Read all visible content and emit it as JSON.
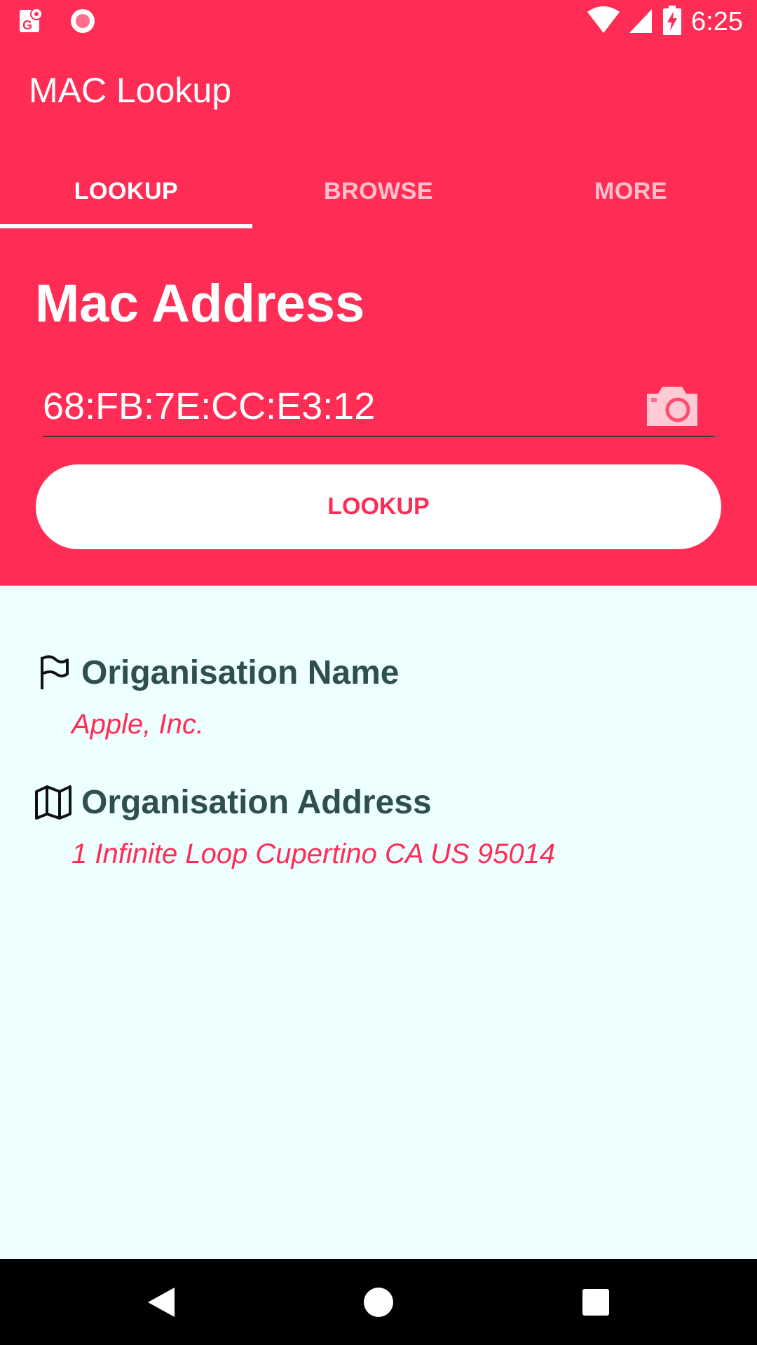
{
  "status_bar": {
    "time": "6:25",
    "icons": [
      "gallery-map-icon",
      "record-icon",
      "wifi-icon",
      "signal-icon",
      "battery-charging-icon"
    ]
  },
  "app_bar": {
    "title": "MAC Lookup"
  },
  "tabs": [
    {
      "label": "LOOKUP",
      "selected": true
    },
    {
      "label": "BROWSE",
      "selected": false
    },
    {
      "label": "MORE",
      "selected": false
    }
  ],
  "form": {
    "heading": "Mac Address",
    "mac_value": "68:FB:7E:CC:E3:12",
    "camera_icon": "camera-icon",
    "lookup_label": "LOOKUP"
  },
  "results": {
    "org_name_label": "Origanisation Name",
    "org_name_value": "Apple, Inc.",
    "org_name_icon": "flag-icon",
    "org_address_label": "Organisation Address",
    "org_address_value": "1 Infinite Loop Cupertino CA US 95014",
    "org_address_icon": "map-icon"
  },
  "nav_bar": {
    "icons": [
      "back-icon",
      "home-icon",
      "recents-icon"
    ]
  },
  "colors": {
    "accent": "#FF2D55",
    "background": "#EEFFFF",
    "heading_text": "#2F4F4F",
    "nav_bar": "#000000"
  }
}
